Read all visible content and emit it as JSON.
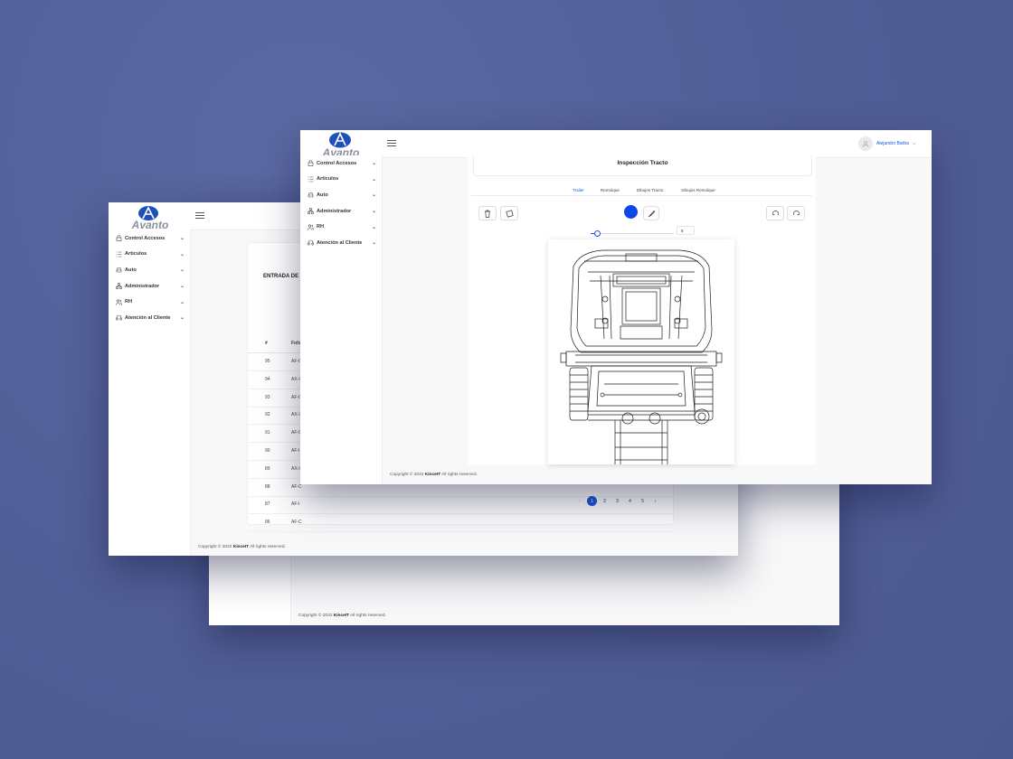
{
  "brand": {
    "name": "Avanto"
  },
  "nav_items": [
    {
      "label": "Control Accesos",
      "icon": "lock-icon"
    },
    {
      "label": "Articulos",
      "icon": "list-icon"
    },
    {
      "label": "Auto",
      "icon": "car-icon"
    },
    {
      "label": "Administrador",
      "icon": "network-icon"
    },
    {
      "label": "RH",
      "icon": "users-icon"
    },
    {
      "label": "Atención al Cliente",
      "icon": "headset-icon"
    }
  ],
  "footer": {
    "prefix": "Copyright © 2022 ",
    "company": "KinceIT",
    "suffix": " All rights reserved."
  },
  "list_window": {
    "title": "ENTRADA DE V",
    "columns": [
      "#",
      "Folio"
    ],
    "rows": [
      {
        "num": "95",
        "folio": "AF-C"
      },
      {
        "num": "94",
        "folio": "AX-I"
      },
      {
        "num": "93",
        "folio": "AF-C"
      },
      {
        "num": "92",
        "folio": "AX-I"
      },
      {
        "num": "91",
        "folio": "AF-C"
      },
      {
        "num": "90",
        "folio": "AF-I"
      },
      {
        "num": "89",
        "folio": "AX-I"
      },
      {
        "num": "88",
        "folio": "AF-C"
      },
      {
        "num": "87",
        "folio": "AF-I"
      },
      {
        "num": "86",
        "folio": "AF-C"
      }
    ],
    "pagination": {
      "prev": "‹",
      "pages": [
        "1",
        "2",
        "3",
        "4",
        "5"
      ],
      "active": "1",
      "next": "›"
    }
  },
  "inspection_window": {
    "title": "Inspección Tracto",
    "tabs": [
      "Trailer",
      "Remolque",
      "Dibujos Tracto",
      "Dibujos Remolque"
    ],
    "active_tab": "Trailer",
    "brush_color": "#0d47e8",
    "stroke_size": "5",
    "user_name": "Alejandro Barba",
    "drawing": "truck-chassis-diagram"
  },
  "colors": {
    "accent": "#1a56db",
    "background": "#53609a"
  }
}
